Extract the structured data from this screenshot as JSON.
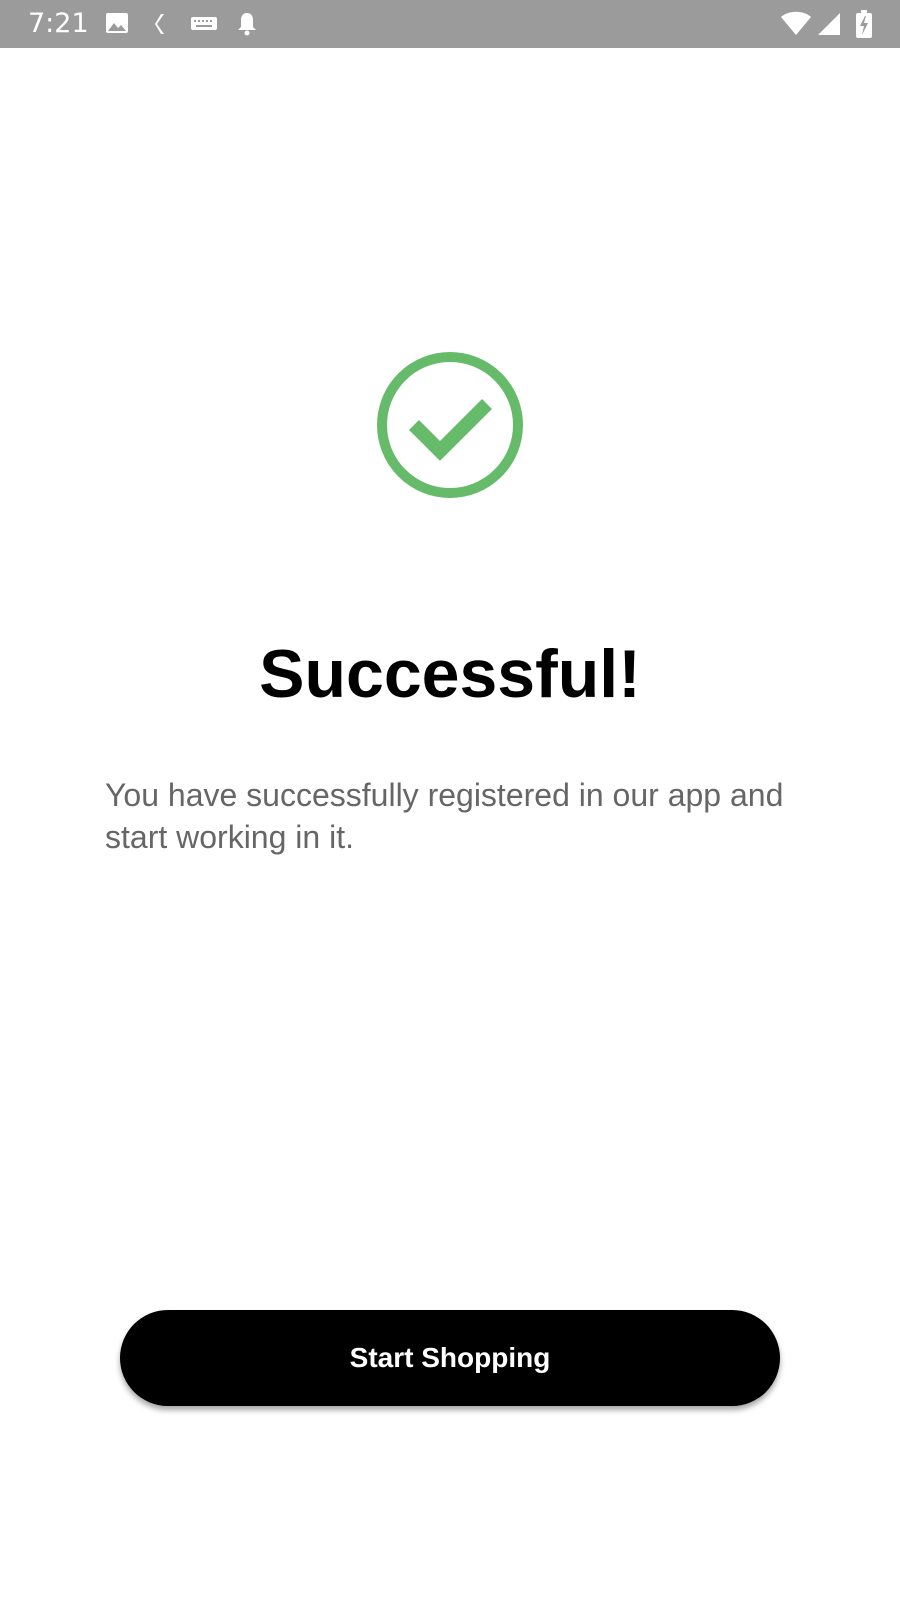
{
  "status_bar": {
    "time": "7:21",
    "left_icons": [
      "image-icon",
      "back-chevron-icon",
      "keyboard-icon",
      "notification-bell-icon"
    ],
    "right_icons": [
      "wifi-icon",
      "cellular-signal-icon",
      "battery-charging-icon"
    ],
    "background_color": "#9b9b9b"
  },
  "success": {
    "icon": "check-circle-icon",
    "icon_color": "#66bb6a",
    "title": "Successful!",
    "message": "You have successfully registered in our app and start working in it."
  },
  "actions": {
    "primary_label": "Start Shopping",
    "primary_color": "#000000"
  }
}
